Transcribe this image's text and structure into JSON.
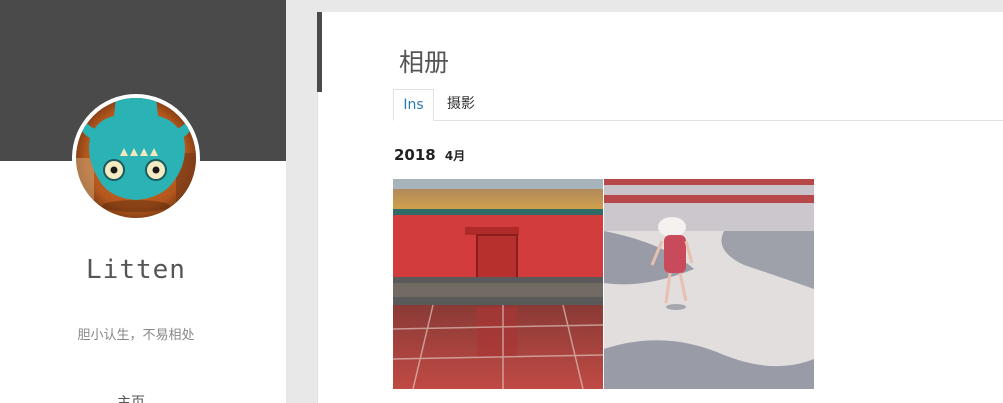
{
  "sidebar": {
    "author_name": "Litten",
    "bio": "胆小认生，不易相处",
    "nav_home": "主页"
  },
  "main": {
    "page_title": "相册",
    "tabs": [
      {
        "label": "Ins",
        "active": true
      },
      {
        "label": "摄影",
        "active": false
      }
    ],
    "album": {
      "year": "2018",
      "month": "4月",
      "photos": [
        {
          "subject": "red palace wall with door reflected on wet ground"
        },
        {
          "subject": "little girl in red dress and white hat running in courtyard"
        }
      ]
    }
  },
  "colors": {
    "banner": "#4a4a4a",
    "active_tab": "#2a7ab8",
    "page_bg": "#e8e8e8"
  }
}
